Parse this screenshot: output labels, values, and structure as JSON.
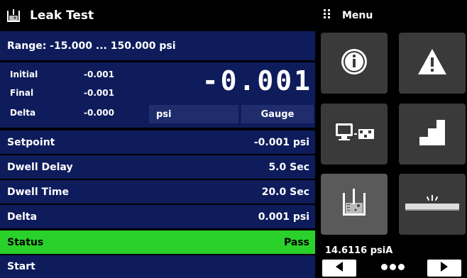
{
  "header": {
    "title": "Leak Test"
  },
  "range": {
    "text": "Range: -15.000 ... 150.000 psi"
  },
  "readings": {
    "initial_label": "Initial",
    "initial_value": "-0.001",
    "final_label": "Final",
    "final_value": "-0.001",
    "delta_label": "Delta",
    "delta_value": "-0.000",
    "big_value": "-0.001",
    "unit": "psi",
    "mode": "Gauge"
  },
  "rows": [
    {
      "label": "Setpoint",
      "value": "-0.001 psi"
    },
    {
      "label": "Dwell Delay",
      "value": "5.0 Sec"
    },
    {
      "label": "Dwell Time",
      "value": "20.0 Sec"
    },
    {
      "label": "Delta",
      "value": "0.001 psi"
    },
    {
      "label": "Status",
      "value": "Pass"
    },
    {
      "label": "Start",
      "value": ""
    }
  ],
  "menu": {
    "title": "Menu",
    "tiles": [
      {
        "icon": "info-icon"
      },
      {
        "icon": "warning-icon"
      },
      {
        "icon": "remote-computer-icon"
      },
      {
        "icon": "step-program-icon"
      },
      {
        "icon": "leak-test-icon"
      },
      {
        "icon": "burst-test-icon"
      }
    ],
    "barometric": "14.6116 psiA"
  },
  "colors": {
    "panel_blue": "#0e1c5c",
    "status_green": "#2ad12a",
    "tile_gray": "#3a3a3a"
  }
}
